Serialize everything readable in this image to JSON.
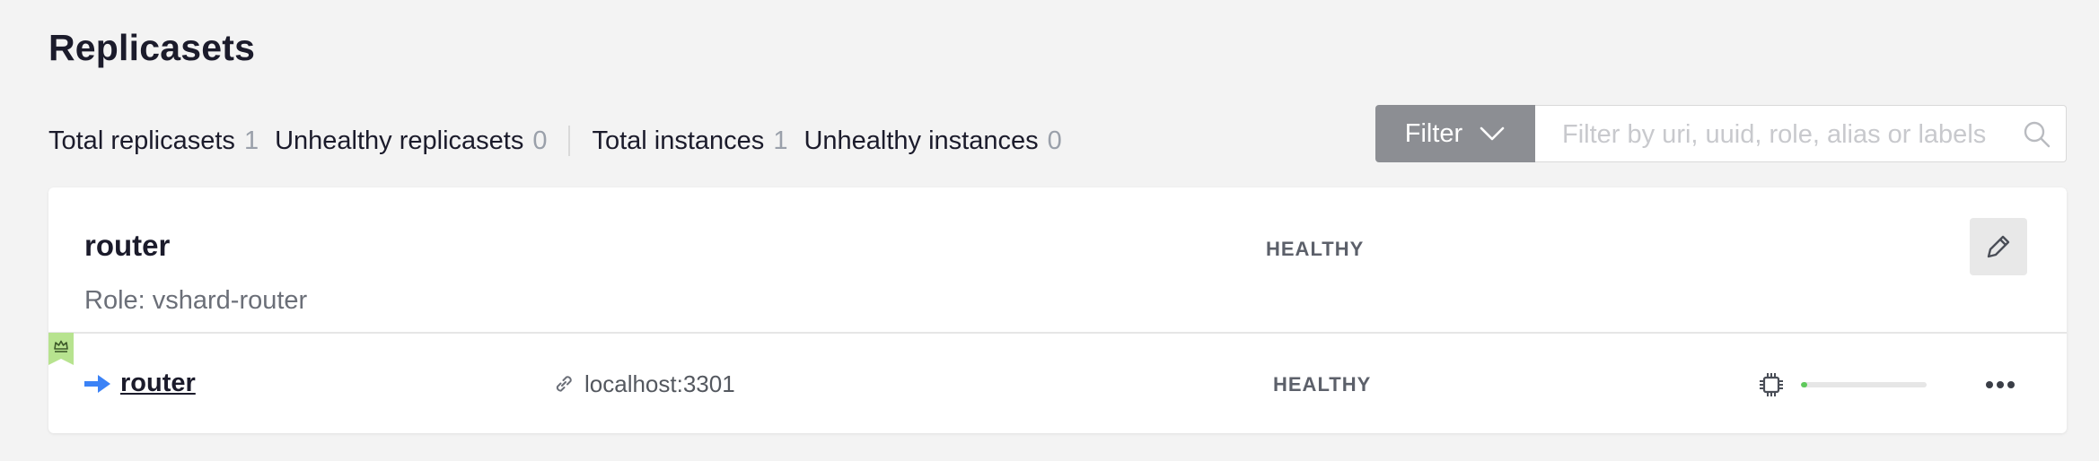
{
  "page": {
    "title": "Replicasets"
  },
  "stats": [
    {
      "label": "Total replicasets",
      "value": "1"
    },
    {
      "label": "Unhealthy replicasets",
      "value": "0"
    },
    {
      "label": "Total instances",
      "value": "1"
    },
    {
      "label": "Unhealthy instances",
      "value": "0"
    }
  ],
  "filter": {
    "button_label": "Filter",
    "placeholder": "Filter by uri, uuid, role, alias or labels",
    "value": ""
  },
  "replicaset": {
    "name": "router",
    "role": "Role: vshard-router",
    "status": "HEALTHY",
    "instances": [
      {
        "name": "router",
        "uri": "localhost:3301",
        "status": "HEALTHY",
        "is_leader": true,
        "memory_usage_fraction": 0.05
      }
    ]
  },
  "colors": {
    "healthy_fill": "#5fc95c",
    "leader_badge": "#b7e38f",
    "arrow": "#3b82f6",
    "filter_button": "#8c8e93"
  },
  "icons": {
    "filter_chevron": "chevron-down-icon",
    "search": "search-icon",
    "edit": "pencil-icon",
    "leader": "crown-icon",
    "current_instance": "arrow-right-icon",
    "uri": "link-icon",
    "cpu": "cpu-icon",
    "more": "more-horizontal-icon"
  }
}
